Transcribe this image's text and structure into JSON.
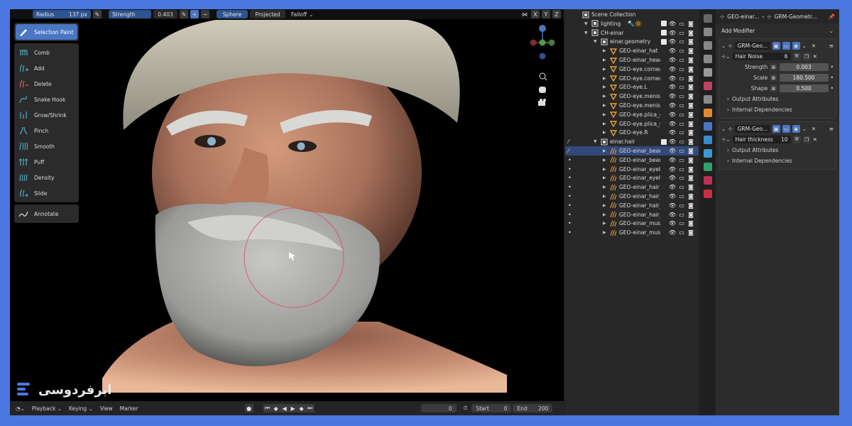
{
  "header": {
    "radius_label": "Radius",
    "radius_value": "137 px",
    "strength_label": "Strength",
    "strength_value": "0.403",
    "mode_sphere": "Sphere",
    "mode_projected": "Projected",
    "falloff_label": "Falloff",
    "axis_x": "X",
    "axis_y": "Y",
    "axis_z": "Z"
  },
  "toolbar": {
    "tools": [
      {
        "label": "Selection Paint",
        "active": true
      },
      {
        "label": "Comb"
      },
      {
        "label": "Add"
      },
      {
        "label": "Delete"
      },
      {
        "label": "Snake Hook"
      },
      {
        "label": "Grow/Shrink"
      },
      {
        "label": "Pinch"
      },
      {
        "label": "Smooth"
      },
      {
        "label": "Puff"
      },
      {
        "label": "Density"
      },
      {
        "label": "Slide"
      },
      {
        "label": "Annotate"
      }
    ]
  },
  "watermark": {
    "text": "ابرفردوسی"
  },
  "timeline": {
    "playback": "Playback",
    "keying": "Keying",
    "view": "View",
    "marker": "Marker",
    "current_frame": "0",
    "start_label": "Start",
    "start_value": "0",
    "end_label": "End",
    "end_value": "200"
  },
  "outliner": {
    "rows": [
      {
        "name": "Scene Collection"
      },
      {
        "name": "lighting"
      },
      {
        "name": "CH-einar"
      },
      {
        "name": "einar.geometry"
      },
      {
        "name": "GEO-einar_hat"
      },
      {
        "name": "GEO-einar_heac"
      },
      {
        "name": "GEO-eye.cornea"
      },
      {
        "name": "GEO-eye.cornea"
      },
      {
        "name": "GEO-eye.L"
      },
      {
        "name": "GEO-eye.menisc"
      },
      {
        "name": "GEO-eye.menisc"
      },
      {
        "name": "GEO-eye.plica_s"
      },
      {
        "name": "GEO-eye.plica_s"
      },
      {
        "name": "GEO-eye.R"
      },
      {
        "name": "einar.hair"
      },
      {
        "name": "GEO-einar_bear",
        "selected": true
      },
      {
        "name": "GEO-einar_bear"
      },
      {
        "name": "GEO-einar_eyeb"
      },
      {
        "name": "GEO-einar_eyela"
      },
      {
        "name": "GEO-einar_hair"
      },
      {
        "name": "GEO-einar_hair_"
      },
      {
        "name": "GEO-einar_hair_"
      },
      {
        "name": "GEO-einar_hair_"
      },
      {
        "name": "GEO-einar_must"
      },
      {
        "name": "GEO-einar_must"
      }
    ]
  },
  "properties": {
    "breadcrumb_object": "GEO-einar...",
    "breadcrumb_modifier": "GRM-Geometr...",
    "add_modifier": "Add Modifier",
    "modifiers": [
      {
        "name": "GRM-Geo...",
        "group": "Hair Noise",
        "users": "6",
        "fields": [
          {
            "label": "Strength",
            "value": "0.003"
          },
          {
            "label": "Scale",
            "value": "180.500"
          },
          {
            "label": "Shape",
            "value": "0.500"
          }
        ],
        "subpanels": [
          "Output Attributes",
          "Internal Dependencies"
        ]
      },
      {
        "name": "GRM-Geo...",
        "group": "Hair thickness",
        "users": "10",
        "fields": [],
        "subpanels": [
          "Output Attributes",
          "Internal Dependencies"
        ]
      }
    ]
  },
  "colors": {
    "accent": "#4a76c4",
    "selected_row": "#33497a",
    "frame": "#4a78e0",
    "curve_icon": "#e89a3c",
    "mesh_icon": "#e8a030"
  }
}
